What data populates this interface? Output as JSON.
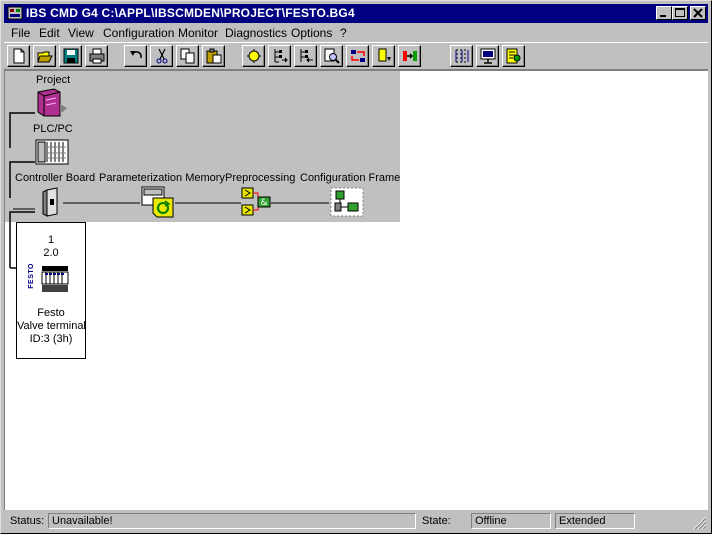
{
  "window": {
    "title": "IBS CMD G4 C:\\APPL\\IBSCMDEN\\PROJECT\\FESTO.BG4",
    "controls": [
      "minimize-icon",
      "maximize-icon",
      "close-icon"
    ]
  },
  "menu": {
    "file": "File",
    "edit": "Edit",
    "view": "View",
    "configuration": "Configuration",
    "monitor": "Monitor",
    "diagnostics": "Diagnostics",
    "options": "Options",
    "help": "?"
  },
  "toolbar": {
    "icons": [
      "new-icon",
      "open-icon",
      "save-icon",
      "print-icon",
      "undo-icon",
      "cut-icon",
      "copy-icon",
      "paste-icon",
      "bus-icon",
      "insert-after-icon",
      "insert-before-icon",
      "search-icon",
      "swap-icon",
      "device-down-icon",
      "connect-icon",
      "grid-icon",
      "monitor-icon",
      "diagnostics-icon"
    ]
  },
  "tree": {
    "project": "Project",
    "plc": "PLC/PC",
    "controller_board": "Controller Board",
    "param_memory": "Parameterization Memory",
    "preprocessing": "Preprocessing",
    "config_frame": "Configuration Frame",
    "colors": {
      "panel": "#c0c0c0",
      "project_icon": "#b0308f",
      "param_icon": "#e8e800"
    }
  },
  "device": {
    "number": "1",
    "position": "2.0",
    "vendor": "Festo",
    "type": "Valve terminal",
    "id": "ID:3 (3h)",
    "logo": "FESTO"
  },
  "status": {
    "status_label": "Status:",
    "status_value": "Unavailable!",
    "state_label": "State:",
    "state_value": "Offline",
    "mode_value": "Extended"
  }
}
